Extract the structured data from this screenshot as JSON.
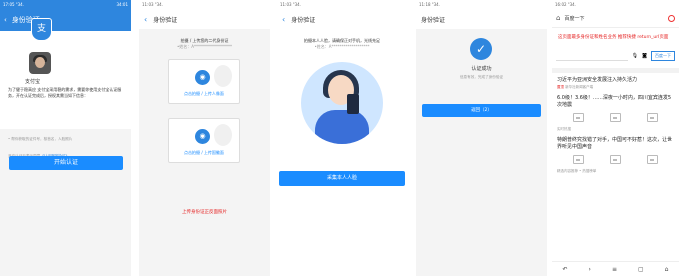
{
  "panel1": {
    "status_time": "17:05 \"34.",
    "status_right": "34:01",
    "nav_title": "身份验证",
    "badge_glyph": "支",
    "app_name": "支付宝",
    "desc": "为了健于稳高应 支付宝采用稳的需求，需要你使用支付宝认证服务，开在认证完成后，授权其需当如下信息：",
    "tip1": "• 帮你获取的证件号，核首名，人脸照片",
    "tip2_prefix": "开启认证后表示同意",
    "tip2_link": "《认证服务协议》",
    "button": "开始认证"
  },
  "panel2": {
    "status": "11:03 \"34.",
    "nav_title": "身份验证",
    "hint1": "拍摄 / 上传您的二代身份证",
    "hint2": "•姓名：A*******************",
    "card1_caption": "点击拍摄 / 上传人像面",
    "card2_caption": "点击拍摄 / 上传国徽面",
    "warning": "上传身份证正反面照片"
  },
  "panel3": {
    "status": "11:03 \"34.",
    "nav_title": "身份验证",
    "hint1": "拍摄本人人脸，请确保正对手机，光线充足",
    "hint2": "•姓名：A*******************",
    "button": "采集本人人脸"
  },
  "panel4": {
    "status": "11:18 \"34.",
    "nav_title": "身份验证",
    "title": "认证成功",
    "subtitle": "信息有效，完成了身份验证",
    "button": "返回（2）"
  },
  "panel5": {
    "status": "16:02 \"34.",
    "search_text": "百度一下",
    "red_text": "这页面最多身份证和姓名业务 推荐快捷 return_url页面",
    "search_btn": "百度一下",
    "news1": "习近平为亚洲安全发展注入持久活力",
    "news1_meta_source": "置顶",
    "news1_meta_rest": " 新华社新闻客户端",
    "news2": "6.0级！3.6级！……深夜一小时内，四川宜宾连发5次地震",
    "section_label": "实时热搜",
    "news3": "特朗普终究找错了对手，中国可不好惹！这次，让世界听见中国声音",
    "bottom_label": "精选内容推荐 • 热搜榜单"
  },
  "colors": {
    "primary": "#2e86de",
    "button": "#1a8cff",
    "warning": "#e52222"
  }
}
